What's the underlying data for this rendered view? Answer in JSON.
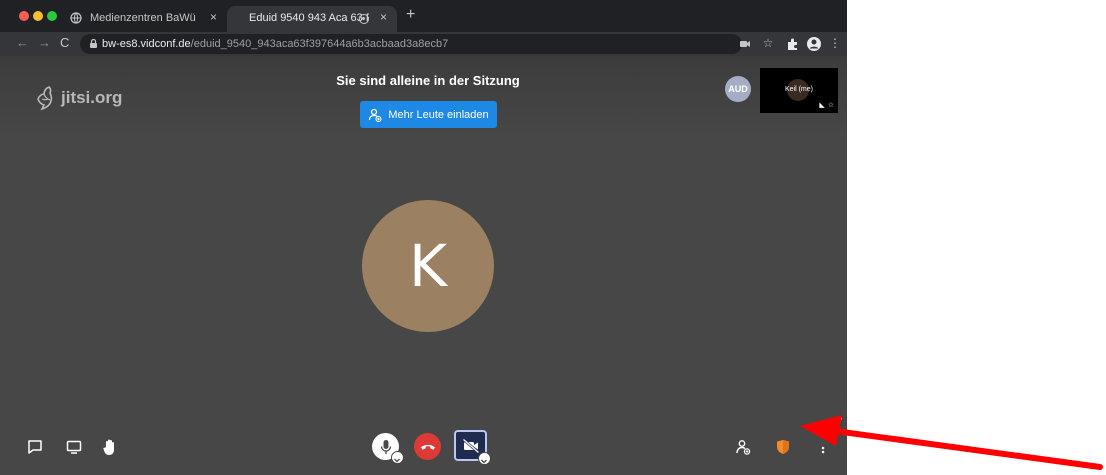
{
  "browser": {
    "tabs": [
      {
        "label": "Medienzentren BaWü",
        "close": "×"
      },
      {
        "label": "Eduid 9540 943 Aca 63 F",
        "close": "×"
      }
    ],
    "new_tab": "+",
    "url_host": "bw-es8.vidconf.de",
    "url_path": "/eduid_9540_943aca63f397644a6b3acbaad3a8ecb7"
  },
  "conference": {
    "logo": "jitsi.org",
    "session_title": "Sie sind alleine in der Sitzung",
    "invite_label": "Mehr Leute einladen",
    "remote_avatar_initials": "AUD",
    "local_thumb_name": "Keil (me)",
    "main_avatar_initial": "K"
  },
  "icons": {
    "chat": "chat-icon",
    "screenshare": "screen-share-icon",
    "raise_hand": "hand-icon",
    "microphone": "microphone-icon",
    "hangup": "phone-hangup-icon",
    "camera": "camera-off-icon",
    "invite": "add-person-icon",
    "security": "shield-icon",
    "more": "more-vertical-icon"
  },
  "colors": {
    "invite_button": "#1e88e5",
    "hangup": "#dc3a35",
    "security_shield": "#f28c28",
    "avatar_main": "#9c8062",
    "annotation_arrow": "#ff0000"
  }
}
